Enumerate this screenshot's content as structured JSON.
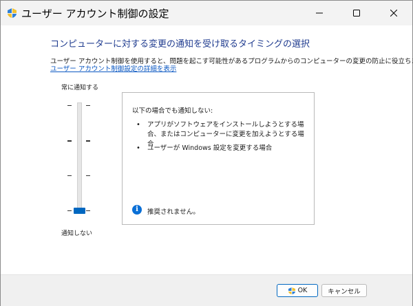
{
  "window": {
    "title": "ユーザー アカウント制御の設定"
  },
  "main": {
    "heading": "コンピューターに対する変更の通知を受け取るタイミングの選択",
    "description": "ユーザー アカウント制御を使用すると、問題を起こす可能性があるプログラムからのコンピューターの変更の防止に役立ちます。",
    "details_link": "ユーザー アカウント制御設定の詳細を表示"
  },
  "slider": {
    "top_label": "常に通知する",
    "bottom_label": "通知しない",
    "levels": 4,
    "current_level": 1
  },
  "panel": {
    "title": "以下の場合でも通知しない:",
    "bullets": [
      "アプリがソフトウェアをインストールしようとする場合、またはコンピューターに変更を加えようとする場合",
      "ユーザーが Windows 設定を変更する場合"
    ],
    "recommendation": "推奨されません。"
  },
  "footer": {
    "ok_label": "OK",
    "cancel_label": "キャンセル"
  },
  "icons": {
    "app": "uac-shield-icon",
    "info": "info-icon",
    "ok_shield": "uac-shield-icon"
  },
  "colors": {
    "accent": "#0067c0",
    "heading": "#1f3b8f",
    "link": "#0a57c2"
  }
}
